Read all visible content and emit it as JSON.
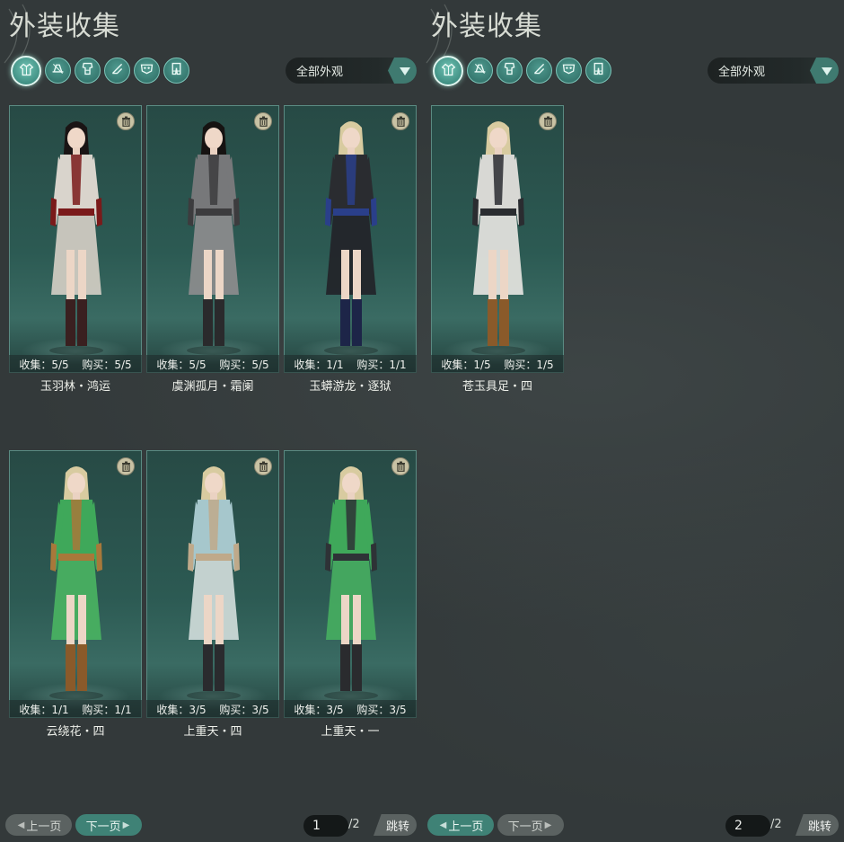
{
  "panels": [
    {
      "title": "外装收集",
      "filter": "全部外观",
      "categories": [
        "clothing-icon",
        "hat-icon",
        "top-icon",
        "shoe-icon",
        "mask-icon",
        "pants-icon"
      ],
      "items": [
        {
          "name": "玉羽林・鸿运",
          "collect": "收集：5/5",
          "buy": "购买：5/5",
          "style": {
            "hair": "#1a1414",
            "top": "#d9d4cc",
            "accent": "#7a1a1a",
            "bottom": "#cfcac1",
            "boots": "#3a2020"
          }
        },
        {
          "name": "虞渊孤月・霜阑",
          "collect": "收集：5/5",
          "buy": "购买：5/5",
          "style": {
            "hair": "#161312",
            "top": "#77787a",
            "accent": "#3c3c3e",
            "bottom": "#8a8b8c",
            "boots": "#2a2a2c"
          }
        },
        {
          "name": "玉蟒游龙・逐狱",
          "collect": "收集：1/1",
          "buy": "购买：1/1",
          "style": {
            "hair": "#d8cba0",
            "top": "#2a2c30",
            "accent": "#2a3f8a",
            "bottom": "#23252a",
            "boots": "#1d2548"
          }
        },
        {
          "name": "云绕花・四",
          "collect": "收集：1/1",
          "buy": "购买：1/1",
          "style": {
            "hair": "#d8cba0",
            "top": "#3fa85a",
            "accent": "#a8783a",
            "bottom": "#49b061",
            "boots": "#8a5a2a"
          }
        },
        {
          "name": "上重天・四",
          "collect": "收集：3/5",
          "buy": "购买：3/5",
          "style": {
            "hair": "#d8cba0",
            "top": "#a6c7cc",
            "accent": "#bfa98a",
            "bottom": "#cbd8d6",
            "boots": "#2a2b2e"
          }
        },
        {
          "name": "上重天・一",
          "collect": "收集：3/5",
          "buy": "购买：3/5",
          "style": {
            "hair": "#d8cba0",
            "top": "#3fa85a",
            "accent": "#2e3236",
            "bottom": "#46ab60",
            "boots": "#2a2b2e"
          }
        }
      ],
      "pager": {
        "prev": "上一页",
        "next": "下一页",
        "current": "1",
        "total": "/2",
        "jump": "跳转",
        "prev_enabled": false,
        "next_enabled": true
      }
    },
    {
      "title": "外装收集",
      "filter": "全部外观",
      "categories": [
        "clothing-icon",
        "hat-icon",
        "top-icon",
        "shoe-icon",
        "mask-icon",
        "pants-icon"
      ],
      "items": [
        {
          "name": "苍玉具足・四",
          "collect": "收集：1/5",
          "buy": "购买：1/5",
          "style": {
            "hair": "#d8cba0",
            "top": "#d8d8d4",
            "accent": "#2a2c30",
            "bottom": "#e0e0dc",
            "boots": "#8a5a2a"
          }
        }
      ],
      "pager": {
        "prev": "上一页",
        "next": "下一页",
        "current": "2",
        "total": "/2",
        "jump": "跳转",
        "prev_enabled": true,
        "next_enabled": false
      }
    }
  ]
}
